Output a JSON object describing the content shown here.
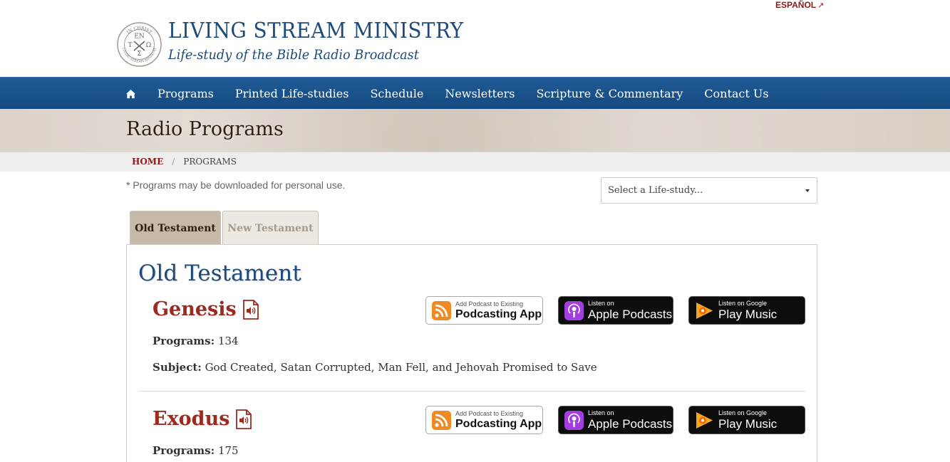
{
  "header": {
    "language_link": "ESPAÑOL",
    "seal": {
      "top": "IN CHRIST",
      "bottom": "LIVING STREAM MINISTRY",
      "center_top": "EN",
      "center_left": "T",
      "center_right": "Ω",
      "center_bottom": "Σ"
    },
    "site_title": "LIVING STREAM MINISTRY",
    "site_subtitle": "Life-study of the Bible Radio Broadcast"
  },
  "nav": {
    "home_icon": "home-icon",
    "items": [
      {
        "label": "Programs"
      },
      {
        "label": "Printed Life-studies"
      },
      {
        "label": "Schedule"
      },
      {
        "label": "Newsletters"
      },
      {
        "label": "Scripture & Commentary"
      },
      {
        "label": "Contact Us"
      }
    ]
  },
  "banner": {
    "title": "Radio Programs"
  },
  "breadcrumb": {
    "home": "HOME",
    "separator": "/",
    "current": "PROGRAMS"
  },
  "note": "* Programs may be downloaded for personal use.",
  "select": {
    "selected": "Select a Life-study..."
  },
  "tabs": [
    {
      "label": "Old Testament",
      "active": true
    },
    {
      "label": "New Testament",
      "active": false
    }
  ],
  "panel": {
    "heading": "Old Testament",
    "books": [
      {
        "title": "Genesis",
        "programs_label": "Programs:",
        "programs": "134",
        "subject_label": "Subject:",
        "subject": "God Created, Satan Corrupted, Man Fell, and Jehovah Promised to Save"
      },
      {
        "title": "Exodus",
        "programs_label": "Programs:",
        "programs": "175"
      }
    ]
  },
  "badges": {
    "rss_small": "Add Podcast to Existing",
    "rss_big": "Podcasting App",
    "apple_small": "Listen on",
    "apple_big": "Apple Podcasts",
    "google_small": "Listen on Google",
    "google_big": "Play Music"
  },
  "colors": {
    "nav_blue": "#1b5590",
    "title_blue": "#1c4a7a",
    "book_red": "#9b2a1f",
    "banner_tan": "#d8cfc3",
    "rss_orange": "#f08a24",
    "podcast_purple": "#a33ee0",
    "play_orange": "#f5a623"
  }
}
